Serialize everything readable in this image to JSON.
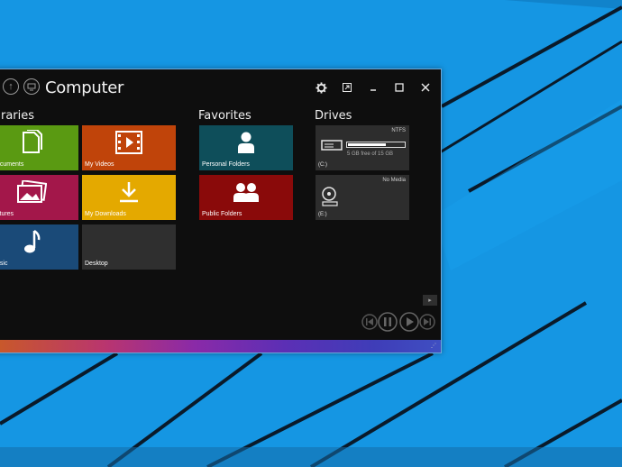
{
  "window": {
    "title": "Computer",
    "back_icon": "back-arrow-icon",
    "drives_icon": "computer-icon"
  },
  "titlebar_controls": [
    "settings-gear-icon",
    "open-external-icon",
    "minimize-icon",
    "maximize-icon",
    "close-icon"
  ],
  "sections": {
    "libraries": "raries",
    "favorites": "Favorites",
    "drives": "Drives"
  },
  "libraries": [
    {
      "label": "ocuments",
      "color": "#5a9a12",
      "icon": "documents-icon"
    },
    {
      "label": "My Videos",
      "color": "#c0440a",
      "icon": "video-icon"
    },
    {
      "label": "ctures",
      "color": "#a3174a",
      "icon": "pictures-icon"
    },
    {
      "label": "My Downloads",
      "color": "#e4a900",
      "icon": "download-icon"
    },
    {
      "label": "usic",
      "color": "#1a4a78",
      "icon": "music-icon"
    },
    {
      "label": "Desktop",
      "color": "#2f2f2f",
      "icon": "desktop-icon"
    }
  ],
  "favorites": [
    {
      "label": "Personal Folders",
      "color": "#0e4e5a",
      "icon": "person-icon"
    },
    {
      "label": "Public Folders",
      "color": "#8a0a0a",
      "icon": "people-icon"
    }
  ],
  "drives": [
    {
      "letter": "(C:)",
      "filesystem": "NTFS",
      "free_text": "5 GB free of 15 GB",
      "used_fraction": 0.67,
      "icon": "hard-drive-icon"
    },
    {
      "letter": "(E:)",
      "filesystem": "No Media",
      "icon": "optical-drive-icon"
    }
  ],
  "media_controls": [
    "skip-back-icon",
    "pause-icon",
    "play-icon",
    "skip-forward-icon"
  ],
  "colors": {
    "desktop_bg": "#1596e3",
    "window_bg": "#0e0e0e",
    "window_border": "#6aa7d8"
  }
}
